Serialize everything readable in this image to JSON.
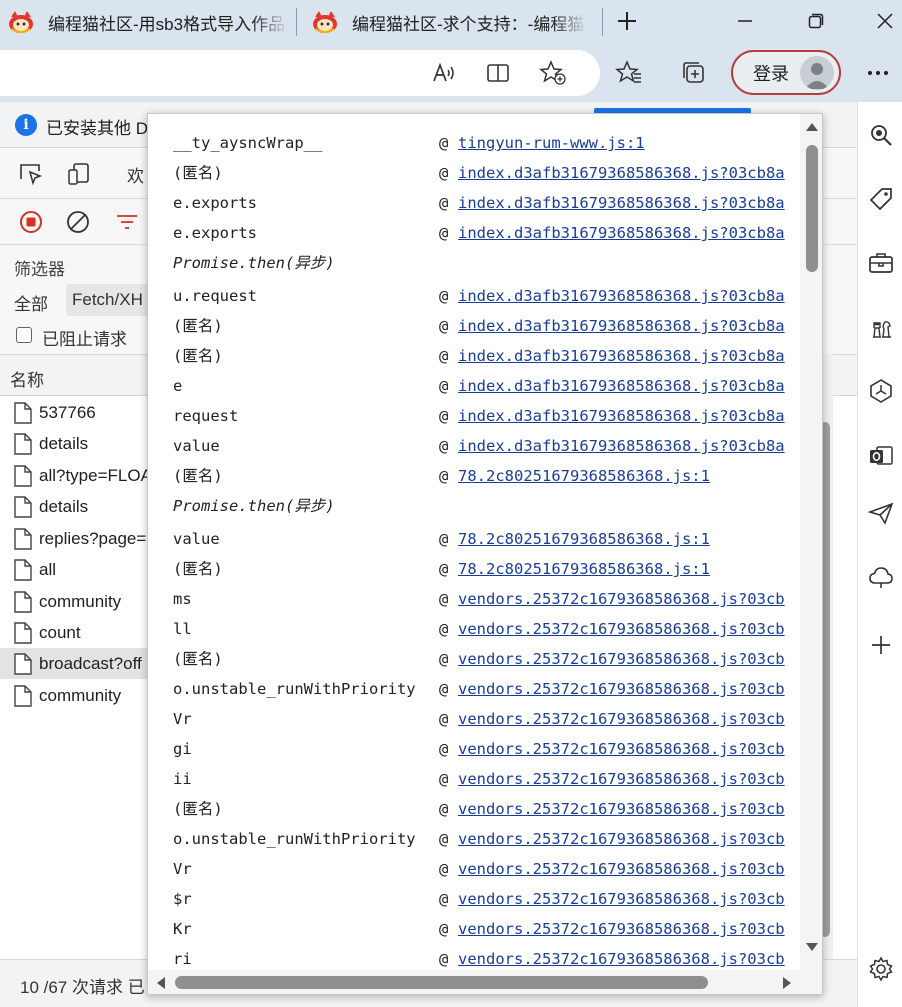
{
  "browser": {
    "tabs": [
      {
        "title": "编程猫社区-用sb3格式导入作品"
      },
      {
        "title": "编程猫社区-求个支持：-编程猫社区"
      }
    ],
    "login_label": "登录",
    "icons": [
      "read-aloud-icon",
      "reader-view-icon",
      "add-favorite-icon",
      "favorites-icon",
      "collections-icon",
      "more-icon"
    ]
  },
  "sidebar": {
    "icons": [
      "search-icon",
      "shopping-tag-icon",
      "tools-icon",
      "chess-icon",
      "office-icon",
      "outlook-icon",
      "send-icon",
      "cloud-icon",
      "add-icon",
      "settings-icon"
    ]
  },
  "devtools": {
    "info_text": "已安装其他 D",
    "toolbar_text": "欢",
    "filter_label": "筛选器",
    "filter_all": "全部",
    "filter_fetch": "Fetch/XH",
    "blocked_label": "已阻止请求",
    "name_header": "名称",
    "requests": [
      {
        "name": "537766"
      },
      {
        "name": "details"
      },
      {
        "name": "all?type=FLOA"
      },
      {
        "name": "details"
      },
      {
        "name": "replies?page="
      },
      {
        "name": "all"
      },
      {
        "name": "community"
      },
      {
        "name": "count"
      },
      {
        "name": "broadcast?off"
      },
      {
        "name": "community"
      }
    ],
    "status_text": "10 /67 次请求  已"
  },
  "callstack": {
    "at_symbol": "@",
    "frames": [
      {
        "fn": "__ty_aysncWrap__",
        "src": "tingyun-rum-www.js:1"
      },
      {
        "fn": "(匿名)",
        "src": "index.d3afb31679368586368.js?03cb8a"
      },
      {
        "fn": "e.exports",
        "src": "index.d3afb31679368586368.js?03cb8a"
      },
      {
        "fn": "e.exports",
        "src": "index.d3afb31679368586368.js?03cb8a"
      },
      {
        "fn": "Promise.then(异步)",
        "src": "",
        "async": true
      },
      {
        "fn": "u.request",
        "src": "index.d3afb31679368586368.js?03cb8a"
      },
      {
        "fn": "(匿名)",
        "src": "index.d3afb31679368586368.js?03cb8a"
      },
      {
        "fn": "(匿名)",
        "src": "index.d3afb31679368586368.js?03cb8a"
      },
      {
        "fn": "e",
        "src": "index.d3afb31679368586368.js?03cb8a"
      },
      {
        "fn": "request",
        "src": "index.d3afb31679368586368.js?03cb8a"
      },
      {
        "fn": "value",
        "src": "index.d3afb31679368586368.js?03cb8a"
      },
      {
        "fn": "(匿名)",
        "src": "78.2c80251679368586368.js:1"
      },
      {
        "fn": "Promise.then(异步)",
        "src": "",
        "async": true
      },
      {
        "fn": "value",
        "src": "78.2c80251679368586368.js:1"
      },
      {
        "fn": "(匿名)",
        "src": "78.2c80251679368586368.js:1"
      },
      {
        "fn": "ms",
        "src": "vendors.25372c1679368586368.js?03cb"
      },
      {
        "fn": "ll",
        "src": "vendors.25372c1679368586368.js?03cb"
      },
      {
        "fn": "(匿名)",
        "src": "vendors.25372c1679368586368.js?03cb"
      },
      {
        "fn": "o.unstable_runWithPriority",
        "src": "vendors.25372c1679368586368.js?03cb"
      },
      {
        "fn": "Vr",
        "src": "vendors.25372c1679368586368.js?03cb"
      },
      {
        "fn": "gi",
        "src": "vendors.25372c1679368586368.js?03cb"
      },
      {
        "fn": "ii",
        "src": "vendors.25372c1679368586368.js?03cb"
      },
      {
        "fn": "(匿名)",
        "src": "vendors.25372c1679368586368.js?03cb"
      },
      {
        "fn": "o.unstable_runWithPriority",
        "src": "vendors.25372c1679368586368.js?03cb"
      },
      {
        "fn": "Vr",
        "src": "vendors.25372c1679368586368.js?03cb"
      },
      {
        "fn": "$r",
        "src": "vendors.25372c1679368586368.js?03cb"
      },
      {
        "fn": "Kr",
        "src": "vendors.25372c1679368586368.js?03cb"
      },
      {
        "fn": "ri",
        "src": "vendors.25372c1679368586368.js?03cb"
      }
    ]
  },
  "colors": {
    "chrome_bg": "#d9e4ee",
    "link": "#1a3e96",
    "login_border": "#b83c3c"
  }
}
